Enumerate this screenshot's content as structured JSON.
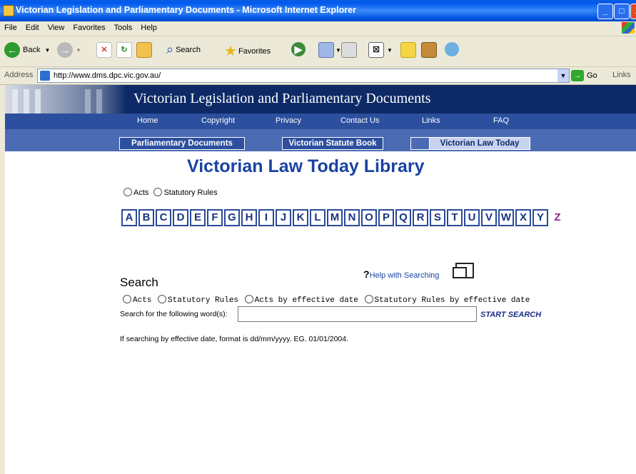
{
  "window": {
    "title": "Victorian Legislation and Parliamentary Documents - Microsoft Internet Explorer",
    "controls": [
      "_",
      "□",
      "X"
    ]
  },
  "menu": [
    "File",
    "Edit",
    "View",
    "Favorites",
    "Tools",
    "Help"
  ],
  "toolbar": {
    "back_label": "Back",
    "search_label": "Search",
    "favorites_label": "Favorites"
  },
  "address": {
    "label": "Address",
    "url": "http://www.dms.dpc.vic.gov.au/",
    "go_label": "Go",
    "links_label": "Links"
  },
  "banner": {
    "title": "Victorian Legislation and Parliamentary Documents"
  },
  "nav": [
    "Home",
    "Copyright",
    "Privacy",
    "Contact Us",
    "Links",
    "FAQ"
  ],
  "tabs": [
    "Parliamentary Documents",
    "Victorian Statute Book",
    "Victorian Law Today"
  ],
  "page": {
    "title": "Victorian Law Today Library",
    "browse_options": [
      "Acts",
      "Statutory Rules"
    ],
    "letters": [
      "A",
      "B",
      "C",
      "D",
      "E",
      "F",
      "G",
      "H",
      "I",
      "J",
      "K",
      "L",
      "M",
      "N",
      "O",
      "P",
      "Q",
      "R",
      "S",
      "T",
      "U",
      "V",
      "W",
      "X",
      "Y",
      "Z"
    ],
    "search_heading": "Search",
    "help_icon": "?",
    "help_text": "Help with Searching",
    "search_options": [
      "Acts",
      "Statutory Rules",
      "Acts by effective date",
      "Statutory Rules by effective date"
    ],
    "search_label": "Search for the following word(s):",
    "search_value": "",
    "search_button": "START SEARCH",
    "note": "If searching by effective date, format is dd/mm/yyyy. EG. 01/01/2004."
  }
}
